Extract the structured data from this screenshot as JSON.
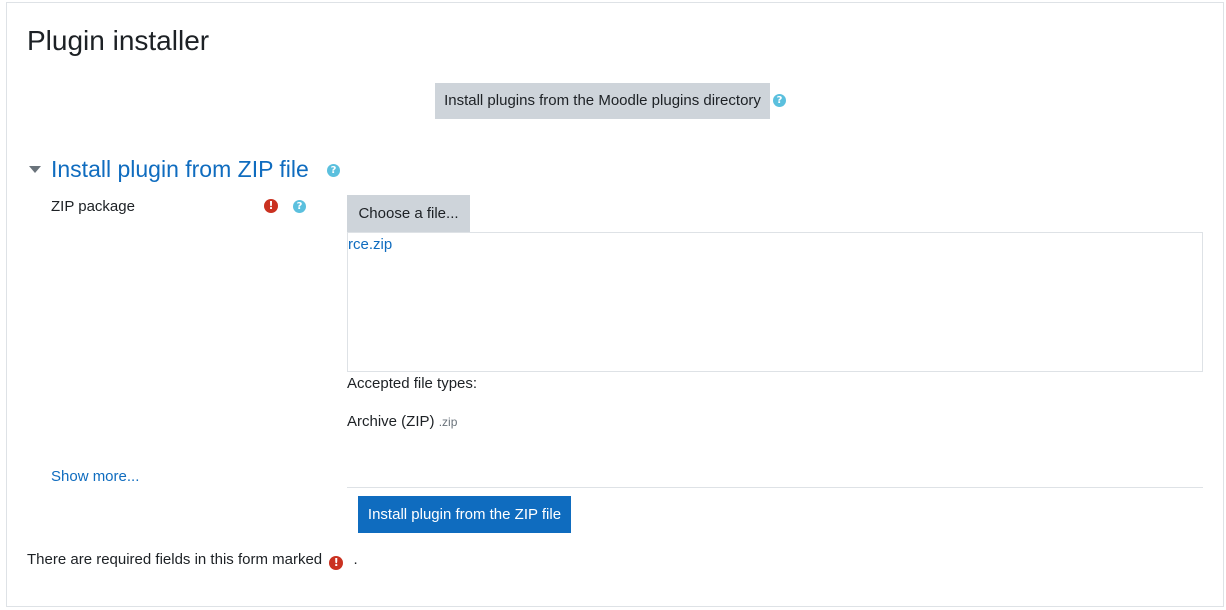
{
  "page": {
    "title": "Plugin installer"
  },
  "directory": {
    "button_label": "Install plugins from the Moodle plugins directory"
  },
  "zip_section": {
    "title": "Install plugin from ZIP file",
    "field_label": "ZIP package",
    "choose_label": "Choose a file...",
    "file_name": "rce.zip",
    "accepted_label": "Accepted file types:",
    "accepted_type": "Archive (ZIP)",
    "accepted_ext": ".zip",
    "show_more": "Show more...",
    "submit_label": "Install plugin from the ZIP file"
  },
  "footer": {
    "required_note": "There are required fields in this form marked",
    "required_note_end": "."
  },
  "icons": {
    "help": "?",
    "required": "!"
  },
  "colors": {
    "accent": "#0f6cbf",
    "button_gray": "#ced4da",
    "help": "#5bc0de",
    "required": "#ca3120"
  }
}
